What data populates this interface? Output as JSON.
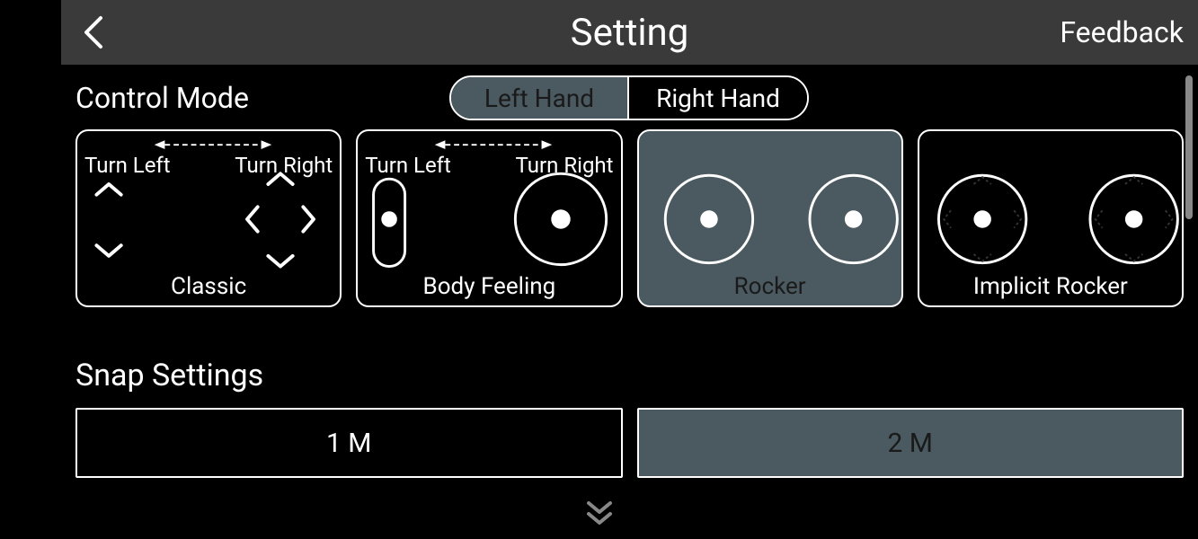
{
  "header": {
    "title": "Setting",
    "feedback_label": "Feedback"
  },
  "control_mode": {
    "section_label": "Control Mode",
    "hand_options": [
      "Left Hand",
      "Right Hand"
    ],
    "hand_selected_index": 0,
    "turn_left_label": "Turn Left",
    "turn_right_label": "Turn Right",
    "modes": [
      {
        "label": "Classic"
      },
      {
        "label": "Body Feeling"
      },
      {
        "label": "Rocker"
      },
      {
        "label": "Implicit Rocker"
      }
    ],
    "selected_mode_index": 2
  },
  "snap_settings": {
    "section_label": "Snap Settings",
    "options": [
      "1 M",
      "2 M"
    ],
    "selected_index": 1
  },
  "colors": {
    "selected_bg": "#4a5a60",
    "topbar": "#3a3a3a"
  }
}
